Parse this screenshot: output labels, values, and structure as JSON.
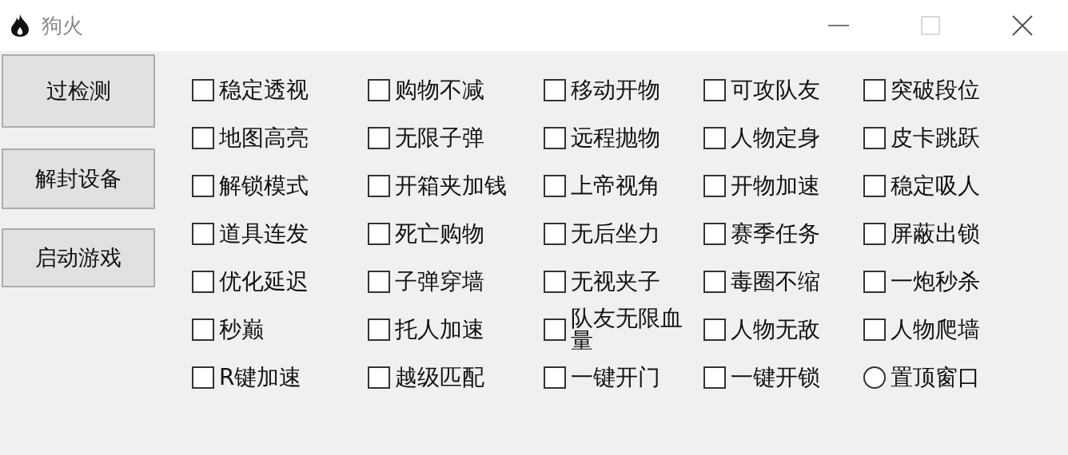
{
  "window": {
    "title": "狗火"
  },
  "buttons": [
    "过检测",
    "解封设备",
    "启动游戏"
  ],
  "options": [
    {
      "kind": "checkbox",
      "label": "稳定透视",
      "checked": false
    },
    {
      "kind": "checkbox",
      "label": "购物不减",
      "checked": false
    },
    {
      "kind": "checkbox",
      "label": "移动开物",
      "checked": false
    },
    {
      "kind": "checkbox",
      "label": "可攻队友",
      "checked": false
    },
    {
      "kind": "checkbox",
      "label": "突破段位",
      "checked": false
    },
    {
      "kind": "checkbox",
      "label": "地图高亮",
      "checked": false
    },
    {
      "kind": "checkbox",
      "label": "无限子弹",
      "checked": false
    },
    {
      "kind": "checkbox",
      "label": "远程抛物",
      "checked": false
    },
    {
      "kind": "checkbox",
      "label": "人物定身",
      "checked": false
    },
    {
      "kind": "checkbox",
      "label": "皮卡跳跃",
      "checked": false
    },
    {
      "kind": "checkbox",
      "label": "解锁模式",
      "checked": false
    },
    {
      "kind": "checkbox",
      "label": "开箱夹加钱",
      "checked": false
    },
    {
      "kind": "checkbox",
      "label": "上帝视角",
      "checked": false
    },
    {
      "kind": "checkbox",
      "label": "开物加速",
      "checked": false
    },
    {
      "kind": "checkbox",
      "label": "稳定吸人",
      "checked": false
    },
    {
      "kind": "checkbox",
      "label": "道具连发",
      "checked": false
    },
    {
      "kind": "checkbox",
      "label": "死亡购物",
      "checked": false
    },
    {
      "kind": "checkbox",
      "label": "无后坐力",
      "checked": false
    },
    {
      "kind": "checkbox",
      "label": "赛季任务",
      "checked": false
    },
    {
      "kind": "checkbox",
      "label": "屏蔽出锁",
      "checked": false
    },
    {
      "kind": "checkbox",
      "label": "优化延迟",
      "checked": false
    },
    {
      "kind": "checkbox",
      "label": "子弹穿墙",
      "checked": false
    },
    {
      "kind": "checkbox",
      "label": "无视夹子",
      "checked": false
    },
    {
      "kind": "checkbox",
      "label": "毒圈不缩",
      "checked": false
    },
    {
      "kind": "checkbox",
      "label": "一炮秒杀",
      "checked": false
    },
    {
      "kind": "checkbox",
      "label": "秒巅",
      "checked": false
    },
    {
      "kind": "checkbox",
      "label": "托人加速",
      "checked": false
    },
    {
      "kind": "checkbox",
      "label": "队友无限血量",
      "checked": false
    },
    {
      "kind": "checkbox",
      "label": "人物无敌",
      "checked": false
    },
    {
      "kind": "checkbox",
      "label": "人物爬墙",
      "checked": false
    },
    {
      "kind": "checkbox",
      "label": "R键加速",
      "checked": false
    },
    {
      "kind": "checkbox",
      "label": "越级匹配",
      "checked": false
    },
    {
      "kind": "checkbox",
      "label": "一键开门",
      "checked": false
    },
    {
      "kind": "checkbox",
      "label": "一键开锁",
      "checked": false
    },
    {
      "kind": "radio",
      "label": "置顶窗口",
      "selected": false
    }
  ]
}
